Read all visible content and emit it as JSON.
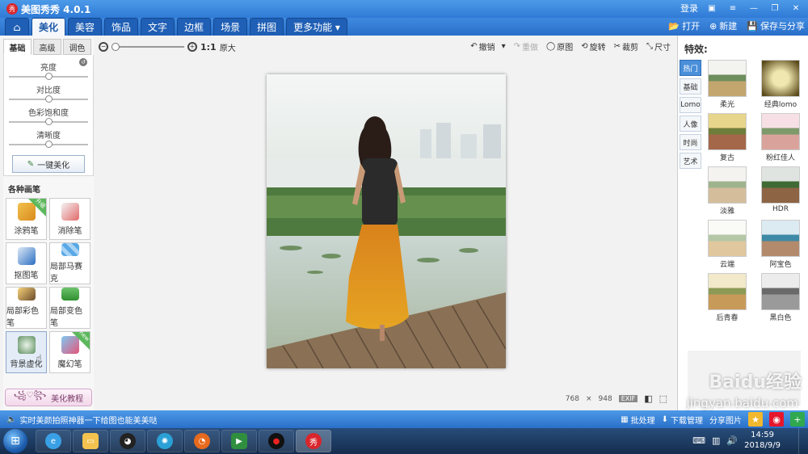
{
  "titlebar": {
    "logo": "秀",
    "title": "美图秀秀 4.0.1",
    "login": "登录"
  },
  "tabs": [
    {
      "label": "⌂",
      "icon": "home-icon"
    },
    {
      "label": "美化"
    },
    {
      "label": "美容"
    },
    {
      "label": "饰品"
    },
    {
      "label": "文字"
    },
    {
      "label": "边框"
    },
    {
      "label": "场景"
    },
    {
      "label": "拼图"
    },
    {
      "label": "更多功能 ▾"
    }
  ],
  "menu_right": {
    "open": "打开",
    "new": "新建",
    "save_share": "保存与分享"
  },
  "left": {
    "subtabs": [
      "基础",
      "高级",
      "调色"
    ],
    "sliders": [
      {
        "label": "亮度",
        "value": 0.5
      },
      {
        "label": "对比度",
        "value": 0.5
      },
      {
        "label": "色彩饱和度",
        "value": 0.5
      },
      {
        "label": "清晰度",
        "value": 0.5
      }
    ],
    "one_key": "一键美化",
    "brush_title": "各种画笔",
    "brushes": [
      {
        "label": "涂鸦笔",
        "badge": "升级"
      },
      {
        "label": "消除笔"
      },
      {
        "label": "抠图笔"
      },
      {
        "label": "局部马赛克"
      },
      {
        "label": "局部彩色笔"
      },
      {
        "label": "局部变色笔"
      },
      {
        "label": "背景虚化"
      },
      {
        "label": "魔幻笔",
        "badge": "new"
      }
    ],
    "tutorial": "美化教程"
  },
  "center": {
    "ratio": "1:1",
    "original_size": "原大",
    "tools": {
      "undo": "撤销",
      "redo": "重做",
      "original": "原图",
      "rotate": "旋转",
      "crop": "裁剪",
      "size": "尺寸"
    },
    "image_width": "768",
    "times": "×",
    "image_height": "948",
    "exif": "EXIF"
  },
  "right": {
    "title": "特效:",
    "categories": [
      "热门",
      "基础",
      "Lomo",
      "人像",
      "时尚",
      "艺术"
    ],
    "effects": [
      {
        "label": "柔光"
      },
      {
        "label": "经典lomo"
      },
      {
        "label": "复古"
      },
      {
        "label": "粉红佳人"
      },
      {
        "label": "淡雅"
      },
      {
        "label": "HDR"
      },
      {
        "label": "云端"
      },
      {
        "label": "阿宝色"
      },
      {
        "label": "后青春"
      },
      {
        "label": "黑白色"
      }
    ]
  },
  "bottombar": {
    "marquee": "实时美颜拍照神器一下给图也能美美哒",
    "batch": "批处理",
    "download_manage": "下载管理",
    "share_pic": "分享图片"
  },
  "taskbar": {
    "time": "14:59",
    "date": "2018/9/9"
  },
  "watermark": {
    "brand": "Baidu经验",
    "url": "jingyan.baidu.com"
  }
}
